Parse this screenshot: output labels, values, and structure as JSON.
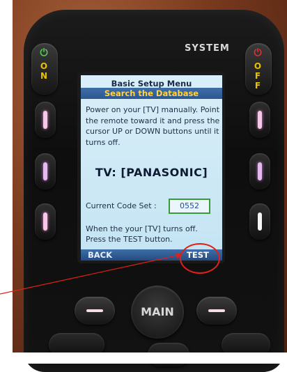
{
  "remote": {
    "system_label": "SYSTEM",
    "on_label": "ON",
    "off_label": "OFF",
    "main_label": "MAIN"
  },
  "screen": {
    "title": "Basic Setup Menu",
    "subtitle": "Search the Database",
    "instructions": "Power on your [TV] manually. Point the remote toward it and press the cursor UP or DOWN buttons until it turns off.",
    "device": "TV: [PANASONIC]",
    "code_set_label": "Current Code Set :",
    "code_set_value": "0552",
    "instructions2": "When the your [TV] turns off. Press the TEST button.",
    "soft_left": "BACK",
    "soft_right": "TEST"
  },
  "colors": {
    "screen_bg": "#c4e4f3",
    "title_bar": "#2c5790",
    "subtitle_text": "#ffd34a",
    "highlight": "#e0201a",
    "power_on": "#4fcf4f",
    "power_off": "#e03030"
  },
  "icons": {
    "power_on": "power-icon",
    "power_off": "power-icon"
  }
}
